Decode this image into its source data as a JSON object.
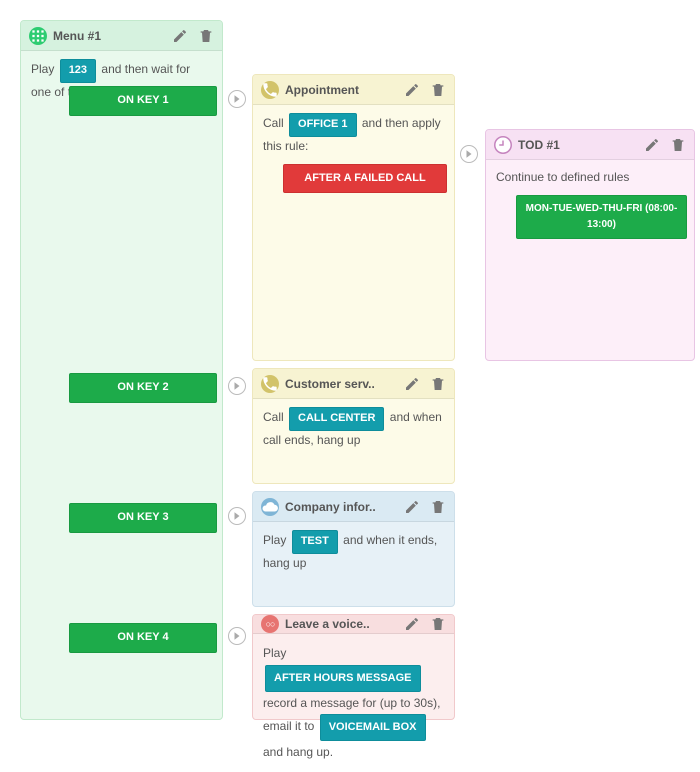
{
  "menu": {
    "title": "Menu #1",
    "sentence_pre": "Play",
    "tag": "123",
    "sentence_post": "and then wait for one of these keys",
    "keys": [
      "ON KEY 1",
      "ON KEY 2",
      "ON KEY 3",
      "ON KEY 4"
    ]
  },
  "appointment": {
    "title": "Appointment",
    "s1": "Call",
    "tag": "OFFICE 1",
    "s2": "and then apply this rule:",
    "bar": "AFTER A FAILED CALL"
  },
  "customer": {
    "title": "Customer serv..",
    "s1": "Call",
    "tag": "CALL CENTER",
    "s2": "and when call ends, hang up"
  },
  "company": {
    "title": "Company infor..",
    "s1": "Play",
    "tag": "TEST",
    "s2": "and when it ends, hang up"
  },
  "voice": {
    "title": "Leave a voice..",
    "s1": "Play",
    "tag1": "AFTER HOURS MESSAGE",
    "s2": "record a message for (up to 30s), email it to",
    "tag2": "VOICEMAIL BOX",
    "s3": "and hang up."
  },
  "tod": {
    "title": "TOD #1",
    "body": "Continue to defined rules",
    "bar": "MON-TUE-WED-THU-FRI (08:00-13:00)"
  }
}
